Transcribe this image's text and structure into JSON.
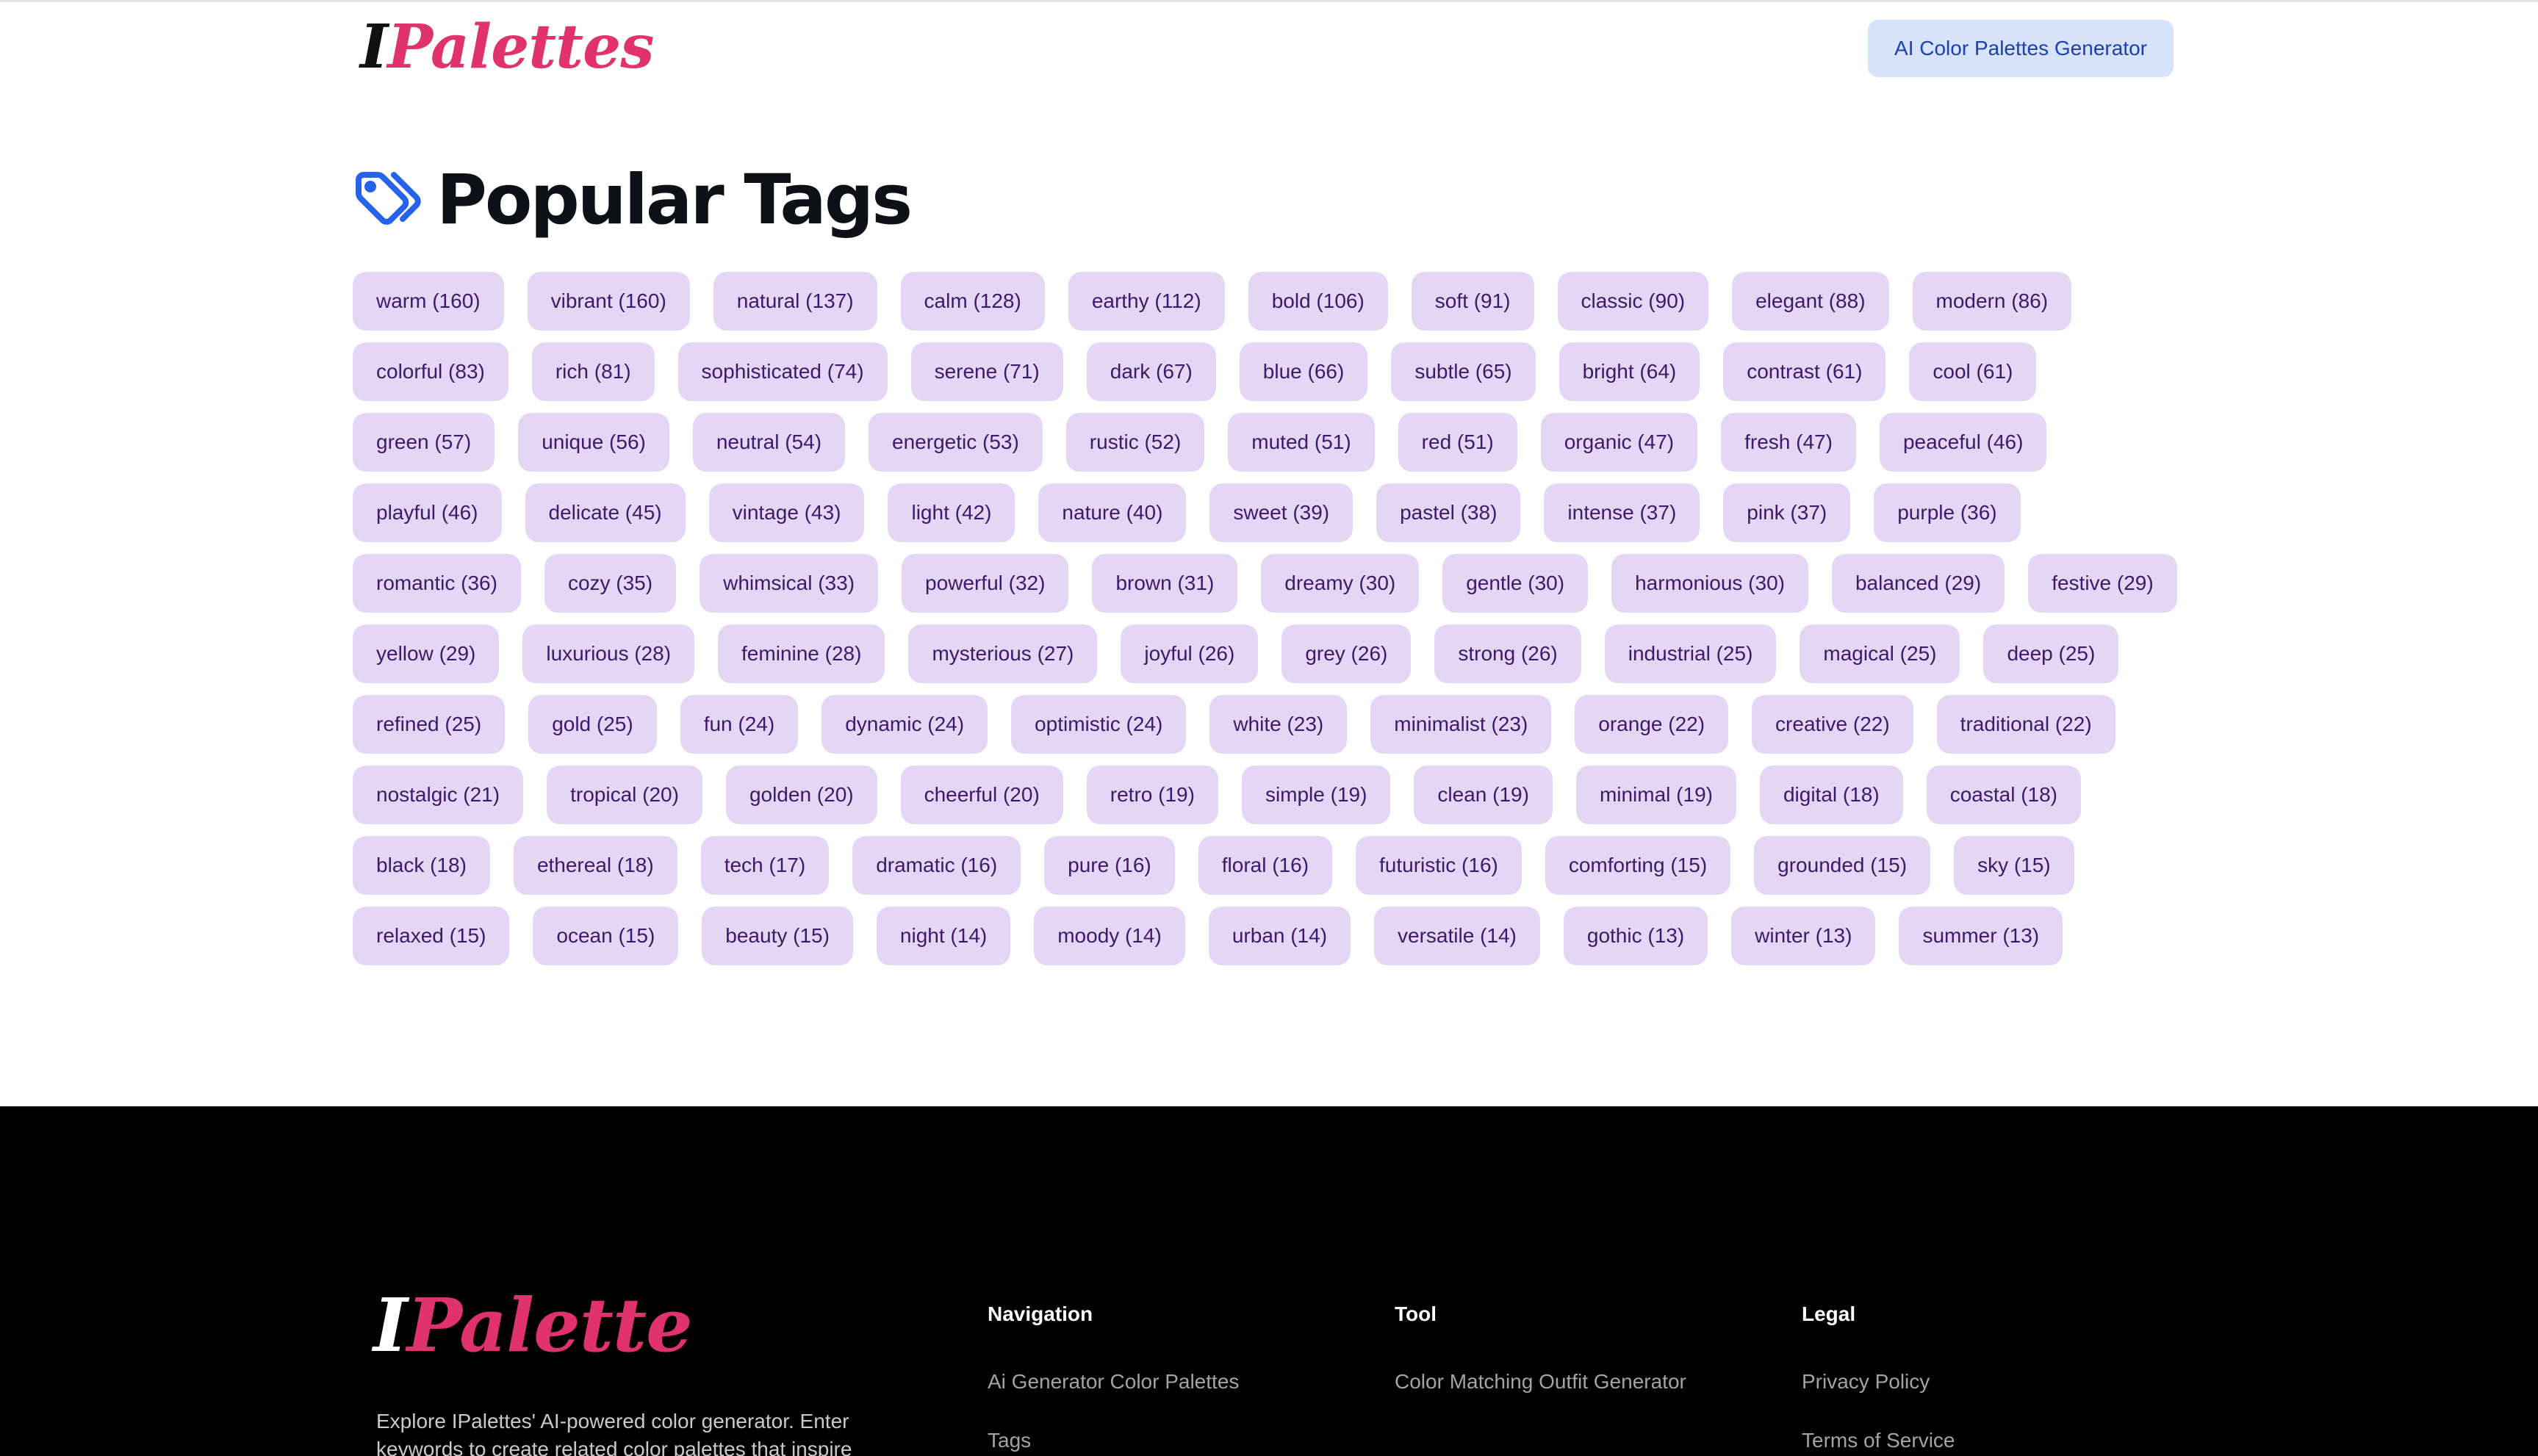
{
  "brand": {
    "name_first": "I",
    "name_rest": "Palettes",
    "accent": "#e0336e"
  },
  "header": {
    "cta_label": "AI Color Palettes Generator"
  },
  "page": {
    "title": "Popular Tags",
    "icon": "tags-icon"
  },
  "tags": [
    "warm (160)",
    "vibrant (160)",
    "natural (137)",
    "calm (128)",
    "earthy (112)",
    "bold (106)",
    "soft (91)",
    "classic (90)",
    "elegant (88)",
    "modern (86)",
    "colorful (83)",
    "rich (81)",
    "sophisticated (74)",
    "serene (71)",
    "dark (67)",
    "blue (66)",
    "subtle (65)",
    "bright (64)",
    "contrast (61)",
    "cool (61)",
    "green (57)",
    "unique (56)",
    "neutral (54)",
    "energetic (53)",
    "rustic (52)",
    "muted (51)",
    "red (51)",
    "organic (47)",
    "fresh (47)",
    "peaceful (46)",
    "playful (46)",
    "delicate (45)",
    "vintage (43)",
    "light (42)",
    "nature (40)",
    "sweet (39)",
    "pastel (38)",
    "intense (37)",
    "pink (37)",
    "purple (36)",
    "romantic (36)",
    "cozy (35)",
    "whimsical (33)",
    "powerful (32)",
    "brown (31)",
    "dreamy (30)",
    "gentle (30)",
    "harmonious (30)",
    "balanced (29)",
    "festive (29)",
    "yellow (29)",
    "luxurious (28)",
    "feminine (28)",
    "mysterious (27)",
    "joyful (26)",
    "grey (26)",
    "strong (26)",
    "industrial (25)",
    "magical (25)",
    "deep (25)",
    "refined (25)",
    "gold (25)",
    "fun (24)",
    "dynamic (24)",
    "optimistic (24)",
    "white (23)",
    "minimalist (23)",
    "orange (22)",
    "creative (22)",
    "traditional (22)",
    "nostalgic (21)",
    "tropical (20)",
    "golden (20)",
    "cheerful (20)",
    "retro (19)",
    "simple (19)",
    "clean (19)",
    "minimal (19)",
    "digital (18)",
    "coastal (18)",
    "black (18)",
    "ethereal (18)",
    "tech (17)",
    "dramatic (16)",
    "pure (16)",
    "floral (16)",
    "futuristic (16)",
    "comforting (15)",
    "grounded (15)",
    "sky (15)",
    "relaxed (15)",
    "ocean (15)",
    "beauty (15)",
    "night (14)",
    "moody (14)",
    "urban (14)",
    "versatile (14)",
    "gothic (13)",
    "winter (13)",
    "summer (13)"
  ],
  "footer": {
    "logo_first": "I",
    "logo_rest": "Palette",
    "description": "Explore IPalettes' AI-powered color generator. Enter keywords to create related color palettes that inspire",
    "columns": [
      {
        "title": "Navigation",
        "links": [
          "Ai Generator Color Palettes",
          "Tags"
        ]
      },
      {
        "title": "Tool",
        "links": [
          "Color Matching Outfit Generator"
        ]
      },
      {
        "title": "Legal",
        "links": [
          "Privacy Policy",
          "Terms of Service"
        ]
      }
    ]
  }
}
